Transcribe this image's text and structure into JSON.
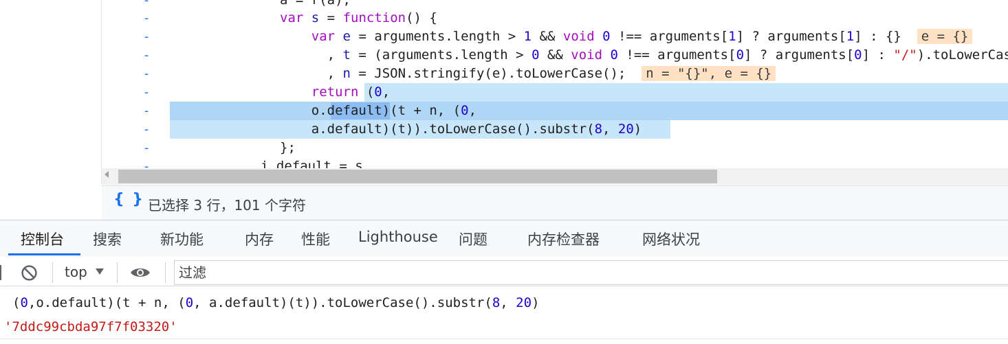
{
  "editor": {
    "change_marker": "-",
    "lines": [
      [
        {
          "t": "a = r(a);"
        }
      ],
      [
        {
          "t": "var",
          "c": "kw"
        },
        {
          "t": " "
        },
        {
          "t": "s",
          "c": "var"
        },
        {
          "t": " = "
        },
        {
          "t": "function",
          "c": "kw"
        },
        {
          "t": "() {"
        }
      ],
      [
        {
          "t": "    "
        },
        {
          "t": "var",
          "c": "kw"
        },
        {
          "t": " "
        },
        {
          "t": "e",
          "c": "var"
        },
        {
          "t": " = arguments.length > "
        },
        {
          "t": "1",
          "c": "num"
        },
        {
          "t": " && "
        },
        {
          "t": "void",
          "c": "kw"
        },
        {
          "t": " "
        },
        {
          "t": "0",
          "c": "num"
        },
        {
          "t": " !== arguments["
        },
        {
          "t": "1",
          "c": "num"
        },
        {
          "t": "] ? arguments["
        },
        {
          "t": "1",
          "c": "num"
        },
        {
          "t": "] : {}  "
        },
        {
          "t": "e = {}",
          "c": "hint"
        }
      ],
      [
        {
          "t": "      , "
        },
        {
          "t": "t",
          "c": "var"
        },
        {
          "t": " = (arguments.length > "
        },
        {
          "t": "0",
          "c": "num"
        },
        {
          "t": " && "
        },
        {
          "t": "void",
          "c": "kw"
        },
        {
          "t": " "
        },
        {
          "t": "0",
          "c": "num"
        },
        {
          "t": " !== arguments["
        },
        {
          "t": "0",
          "c": "num"
        },
        {
          "t": "] ? arguments["
        },
        {
          "t": "0",
          "c": "num"
        },
        {
          "t": "] : "
        },
        {
          "t": "\"/\"",
          "c": "str"
        },
        {
          "t": ").toLowerCase()"
        }
      ],
      [
        {
          "t": "      , "
        },
        {
          "t": "n",
          "c": "var"
        },
        {
          "t": " = JSON.stringify(e).toLowerCase();  "
        },
        {
          "t": "n = \"{}\", e = {}",
          "c": "hint"
        }
      ],
      [
        {
          "t": "    "
        },
        {
          "t": "return",
          "c": "kw"
        },
        {
          "t": " ("
        },
        {
          "t": "0",
          "c": "num"
        },
        {
          "t": ","
        }
      ],
      [
        {
          "t": "    o.default)(t + n, ("
        },
        {
          "t": "0",
          "c": "num"
        },
        {
          "t": ","
        }
      ],
      [
        {
          "t": "    a.default)(t)).toLowerCase().substr("
        },
        {
          "t": "8",
          "c": "num"
        },
        {
          "t": ", "
        },
        {
          "t": "20",
          "c": "num"
        },
        {
          "t": ")"
        }
      ],
      [
        {
          "t": "};"
        }
      ],
      [
        {
          "t": "i.default = s"
        }
      ]
    ]
  },
  "status_bar": {
    "pretty_print_icon": "{ }",
    "selection_info": "已选择 3 行，101 个字符"
  },
  "drawer_tabs": [
    {
      "label": "控制台",
      "active": true
    },
    {
      "label": "搜索",
      "active": false
    },
    {
      "label": "新功能",
      "active": false
    },
    {
      "label": "内存",
      "active": false
    },
    {
      "label": "性能",
      "active": false
    },
    {
      "label": "Lighthouse",
      "active": false
    },
    {
      "label": "问题",
      "active": false
    },
    {
      "label": "内存检查器",
      "active": false
    },
    {
      "label": "网络状况",
      "active": false
    }
  ],
  "console_toolbar": {
    "clear_icon": "block-icon",
    "context": "top",
    "live_expression_icon": "eye-icon",
    "filter_placeholder": "过滤"
  },
  "console": {
    "input_parts": [
      {
        "t": "("
      },
      {
        "t": "0",
        "c": "num"
      },
      {
        "t": ",o.default)(t + n, ("
      },
      {
        "t": "0",
        "c": "num"
      },
      {
        "t": ", a.default)(t)).toLowerCase().substr("
      },
      {
        "t": "8",
        "c": "num"
      },
      {
        "t": ", "
      },
      {
        "t": "20",
        "c": "num"
      },
      {
        "t": ")"
      }
    ],
    "result": "'7ddc99cbda97f7f03320'"
  },
  "colors": {
    "accent": "#1a73e8",
    "keyword": "#a40dbf",
    "number": "#1c00cf",
    "string": "#c41a16",
    "selection": "#c8e6fa",
    "hint_bg": "#ffe1c4"
  }
}
